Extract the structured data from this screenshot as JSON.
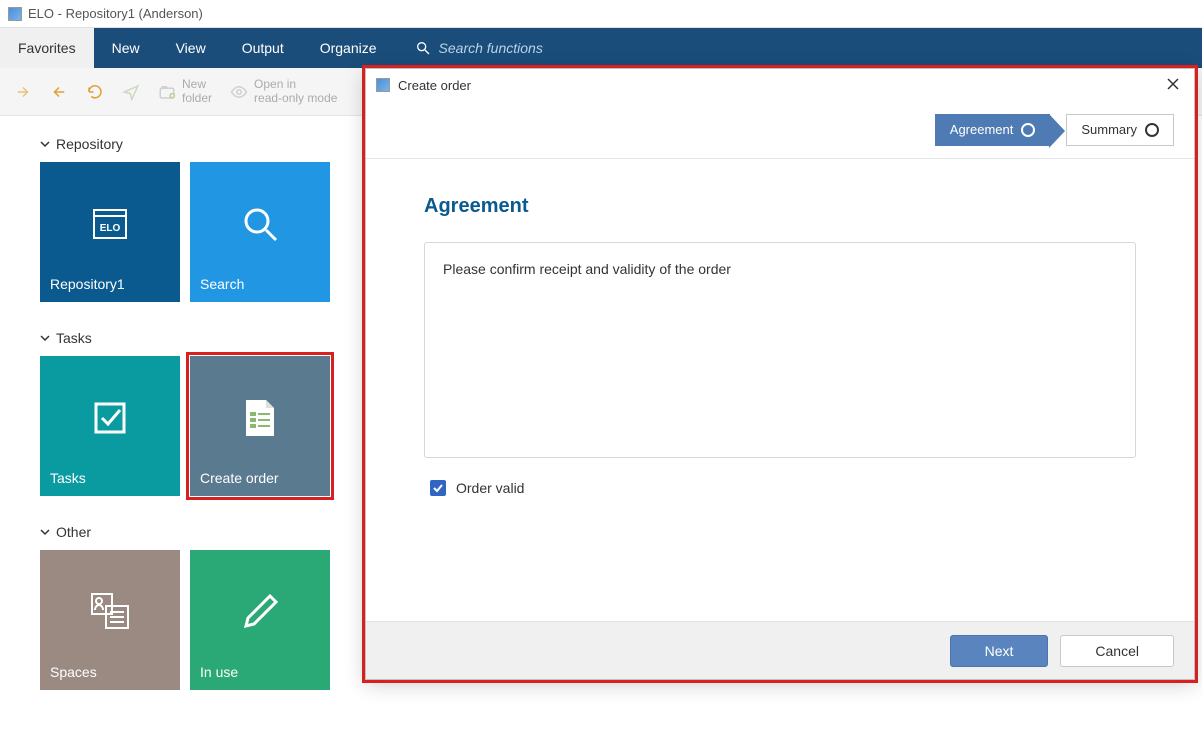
{
  "window": {
    "title": "ELO - Repository1 (Anderson)"
  },
  "menubar": {
    "tabs": [
      "Favorites",
      "New",
      "View",
      "Output",
      "Organize"
    ],
    "active_index": 0,
    "search_placeholder": "Search functions"
  },
  "toolbar": {
    "new_folder": "New folder",
    "open_readonly": "Open in read-only mode"
  },
  "sidebar": {
    "sections": [
      {
        "title": "Repository",
        "tiles": [
          {
            "label": "Repository1",
            "kind": "repo"
          },
          {
            "label": "Search",
            "kind": "search"
          }
        ]
      },
      {
        "title": "Tasks",
        "tiles": [
          {
            "label": "Tasks",
            "kind": "tasks"
          },
          {
            "label": "Create order",
            "kind": "create-order",
            "highlighted": true
          }
        ]
      },
      {
        "title": "Other",
        "tiles": [
          {
            "label": "Spaces",
            "kind": "spaces"
          },
          {
            "label": "In use",
            "kind": "inuse"
          }
        ]
      }
    ]
  },
  "modal": {
    "title": "Create order",
    "steps": [
      {
        "label": "Agreement",
        "active": true
      },
      {
        "label": "Summary",
        "active": false
      }
    ],
    "heading": "Agreement",
    "body_text": "Please confirm receipt and validity of the order",
    "checkbox_label": "Order valid",
    "checkbox_checked": true,
    "buttons": {
      "primary": "Next",
      "secondary": "Cancel"
    }
  }
}
